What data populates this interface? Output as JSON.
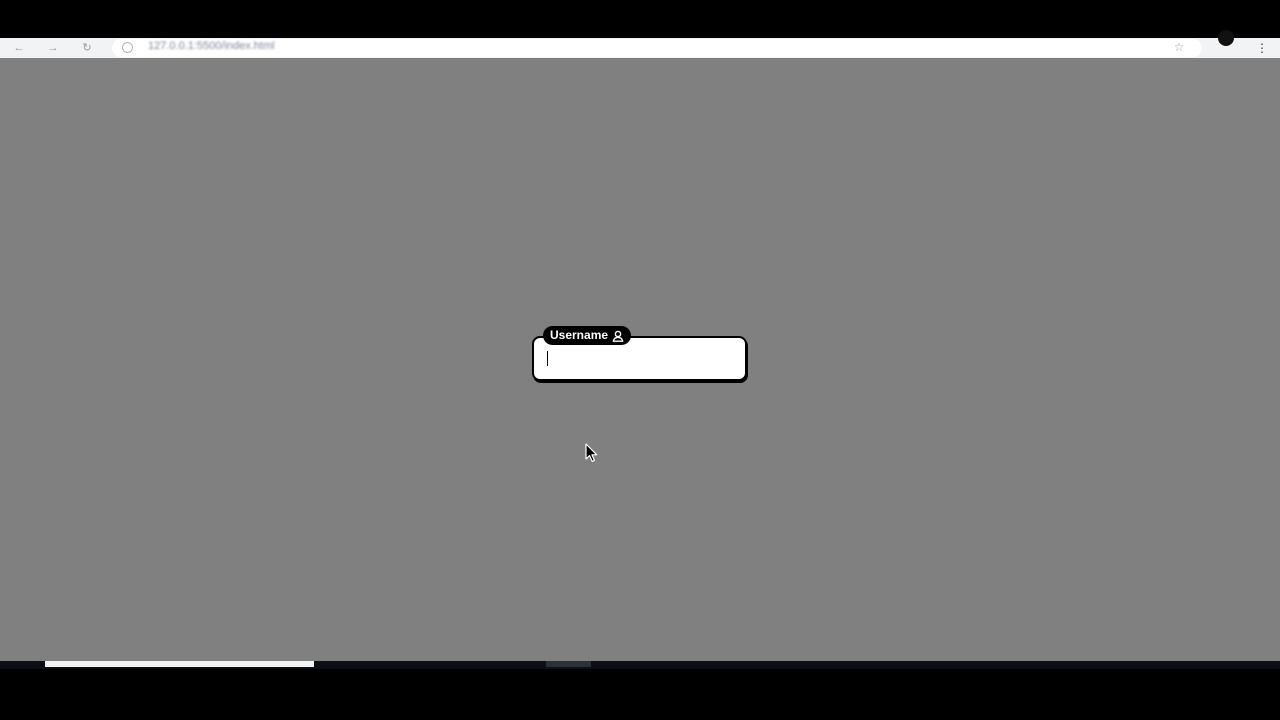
{
  "browser": {
    "url": "127.0.0.1:5500/index.html",
    "back_icon": "back-arrow-icon",
    "forward_icon": "forward-arrow-icon",
    "reload_icon": "reload-icon",
    "bookmark_icon": "star-icon",
    "menu_icon": "kebab-menu-icon"
  },
  "page": {
    "background_color": "#808080",
    "username_field": {
      "label": "Username",
      "icon": "user-icon",
      "value": "",
      "placeholder": ""
    }
  },
  "colors": {
    "label_bg": "#000000",
    "label_text": "#ffffff",
    "input_bg": "#ffffff",
    "input_border": "#000000"
  }
}
